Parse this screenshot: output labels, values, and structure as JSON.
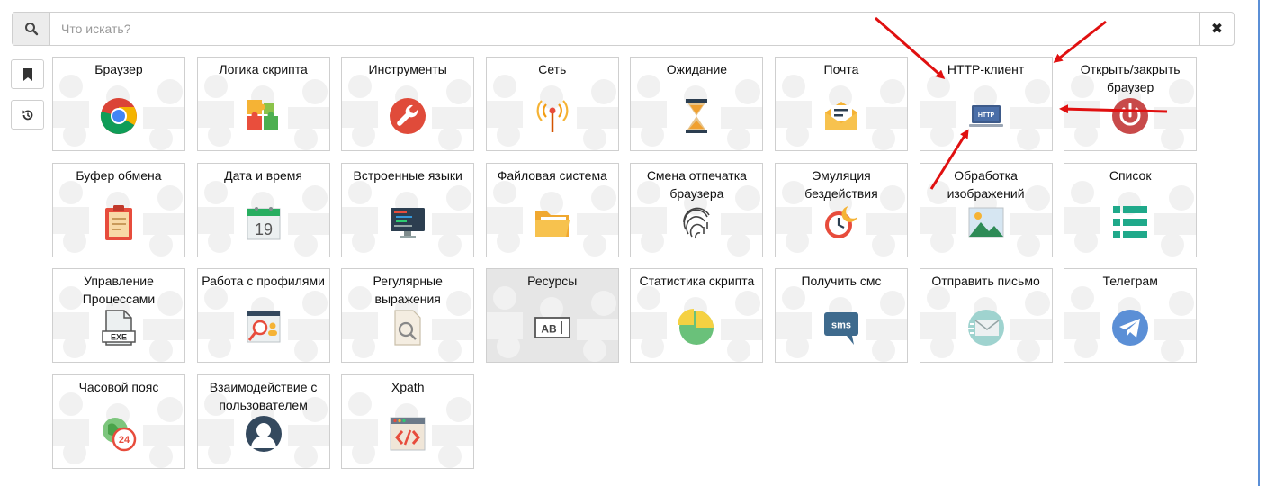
{
  "search": {
    "placeholder": "Что искать?",
    "clear_symbol": "✖"
  },
  "side": [
    {
      "icon": "bookmark-icon"
    },
    {
      "icon": "history-icon"
    }
  ],
  "tiles": [
    {
      "label": "Браузер",
      "icon": "chrome-icon"
    },
    {
      "label": "Логика скрипта",
      "icon": "puzzle-icon"
    },
    {
      "label": "Инструменты",
      "icon": "wrench-icon"
    },
    {
      "label": "Сеть",
      "icon": "antenna-icon"
    },
    {
      "label": "Ожидание",
      "icon": "hourglass-icon"
    },
    {
      "label": "Почта",
      "icon": "mail-icon"
    },
    {
      "label": "HTTP-клиент",
      "icon": "http-laptop-icon",
      "icon_text": "HTTP"
    },
    {
      "label": "Открыть/закрыть браузер",
      "icon": "power-icon"
    },
    {
      "label": "Буфер обмена",
      "icon": "clipboard-icon"
    },
    {
      "label": "Дата и время",
      "icon": "calendar-icon",
      "icon_text": "19"
    },
    {
      "label": "Встроенные языки",
      "icon": "code-monitor-icon"
    },
    {
      "label": "Файловая система",
      "icon": "folder-icon"
    },
    {
      "label": "Смена отпечатка браузера",
      "icon": "fingerprint-icon"
    },
    {
      "label": "Эмуляция бездействия",
      "icon": "sleep-clock-icon"
    },
    {
      "label": "Обработка изображений",
      "icon": "image-icon"
    },
    {
      "label": "Список",
      "icon": "list-icon"
    },
    {
      "label": "Управление Процессами",
      "icon": "exe-file-icon",
      "icon_text": "EXE"
    },
    {
      "label": "Работа с профилями",
      "icon": "profile-search-icon"
    },
    {
      "label": "Регулярные выражения",
      "icon": "regex-doc-icon"
    },
    {
      "label": "Ресурсы",
      "icon": "ab-text-icon",
      "icon_text": "AB",
      "highlighted": true
    },
    {
      "label": "Статистика скрипта",
      "icon": "pie-chart-icon"
    },
    {
      "label": "Получить смс",
      "icon": "sms-icon",
      "icon_text": "sms"
    },
    {
      "label": "Отправить письмо",
      "icon": "send-mail-icon"
    },
    {
      "label": "Телеграм",
      "icon": "telegram-icon"
    },
    {
      "label": "Часовой пояс",
      "icon": "timezone-icon",
      "icon_text": "24"
    },
    {
      "label": "Взаимодействие с пользователем",
      "icon": "user-icon"
    },
    {
      "label": "Xpath",
      "icon": "xpath-code-icon"
    }
  ]
}
